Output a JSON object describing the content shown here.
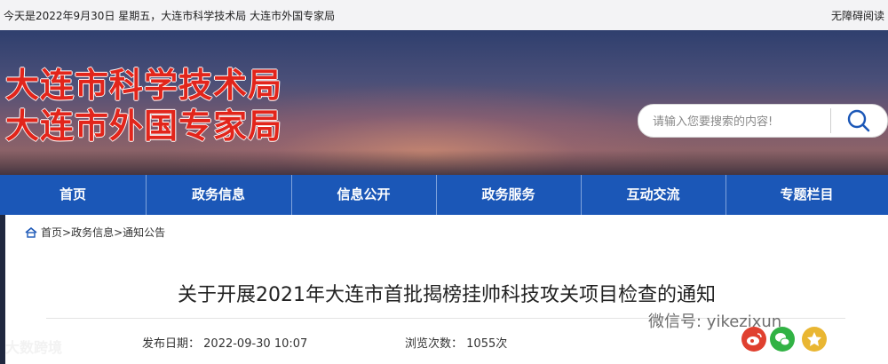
{
  "topbar": {
    "date_text": "今天是2022年9月30日 星期五，大连市科学技术局 大连市外国专家局",
    "accessibility_label": "无障碍阅读"
  },
  "logo": {
    "line1": "大连市科学技术局",
    "line2": "大连市外国专家局",
    "color": "#e2251b"
  },
  "search": {
    "placeholder": "请输入您要搜索的内容!",
    "icon": "search-icon"
  },
  "nav": {
    "items": [
      {
        "label": "首页"
      },
      {
        "label": "政务信息"
      },
      {
        "label": "信息公开"
      },
      {
        "label": "政务服务"
      },
      {
        "label": "互动交流"
      },
      {
        "label": "专题栏目"
      }
    ],
    "bg_color": "#1b57b7"
  },
  "breadcrumb": {
    "icon": "home-icon",
    "items": [
      "首页",
      "政务信息",
      "通知公告"
    ],
    "separator": ">"
  },
  "article": {
    "title": "关于开展2021年大连市首批揭榜挂帅科技攻关项目检查的通知",
    "publish_label": "发布日期：",
    "publish_date": "2022-09-30 10:07",
    "views_label": "浏览次数：",
    "views_count": "1055次"
  },
  "share": {
    "icons": [
      "weibo-icon",
      "wechat-icon",
      "qzone-icon"
    ]
  },
  "watermarks": {
    "left": "大数跨境",
    "right": "微信号: yikezixun"
  }
}
